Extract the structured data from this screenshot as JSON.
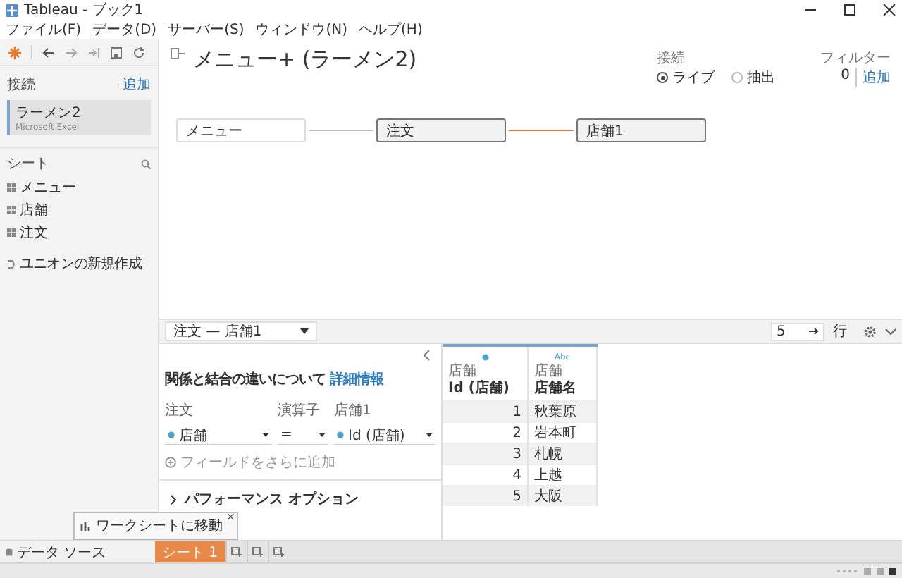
{
  "window": {
    "title": "Tableau - ブック1"
  },
  "menu": [
    "ファイル(F)",
    "データ(D)",
    "サーバー(S)",
    "ウィンドウ(N)",
    "ヘルプ(H)"
  ],
  "sidebar": {
    "connections_label": "接続",
    "add_link": "追加",
    "connections": [
      {
        "name": "ラーメン2",
        "type": "Microsoft Excel",
        "selected": true
      }
    ],
    "sheets_label": "シート",
    "sheets": [
      "メニュー",
      "店舗",
      "注文"
    ],
    "new_union": "ユニオンの新規作成"
  },
  "canvas": {
    "title": "メニュー+ (ラーメン2)",
    "connection": {
      "label": "接続",
      "options": [
        {
          "label": "ライブ",
          "selected": true
        },
        {
          "label": "抽出",
          "selected": false
        }
      ]
    },
    "filters": {
      "label": "フィルター",
      "count": "0",
      "add_link": "追加"
    },
    "tables": [
      {
        "name": "メニュー",
        "kind": "logical"
      },
      {
        "name": "注文",
        "kind": "physical"
      },
      {
        "name": "店舗1",
        "kind": "physical"
      }
    ],
    "links": [
      {
        "selected": false
      },
      {
        "selected": true
      }
    ]
  },
  "join_bar": {
    "dropdown": "注文 — 店舗1",
    "rows": "5",
    "rows_label": "行"
  },
  "join_panel": {
    "info": "関係と結合の違いについて",
    "info_link": "詳細情報",
    "columns": [
      "注文",
      "演算子",
      "店舗1"
    ],
    "clause": [
      {
        "kind": "field",
        "text": "店舗"
      },
      {
        "kind": "operator",
        "text": "="
      },
      {
        "kind": "field",
        "text": "Id (店舗)"
      }
    ],
    "add_field": "フィールドをさらに追加",
    "performance": "パフォーマンス オプション"
  },
  "grid": {
    "columns": [
      {
        "kind": "number",
        "source": "店舗",
        "name": "Id (店舗)"
      },
      {
        "kind": "string",
        "type": "Abc",
        "source": "店舗",
        "name": "店舗名"
      }
    ],
    "rows": [
      [
        "1",
        "秋葉原"
      ],
      [
        "2",
        "岩本町"
      ],
      [
        "3",
        "札幌"
      ],
      [
        "4",
        "上越"
      ],
      [
        "5",
        "大阪"
      ]
    ]
  },
  "tabs": {
    "data_source": "データ ソース",
    "sheets": [
      {
        "label": "シート 1",
        "selected": true
      }
    ]
  },
  "tooltip": {
    "text": "ワークシートに移動",
    "close": "×"
  }
}
